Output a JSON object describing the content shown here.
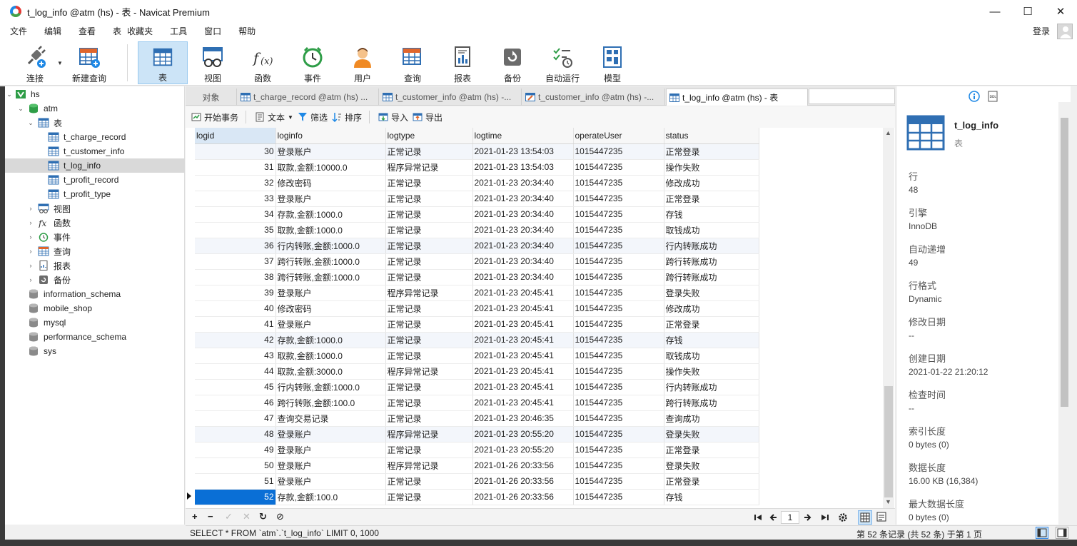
{
  "window": {
    "title": "t_log_info @atm (hs) - 表 - Navicat Premium",
    "controls": {
      "minimize": "—",
      "maximize": "☐",
      "close": "✕"
    }
  },
  "menu": {
    "items": [
      "文件",
      "编辑",
      "查看",
      "表",
      "收藏夹",
      "工具",
      "窗口",
      "帮助"
    ],
    "login": "登录"
  },
  "toolbar": {
    "buttons": [
      "连接",
      "新建查询",
      "表",
      "视图",
      "函数",
      "事件",
      "用户",
      "查询",
      "报表",
      "备份",
      "自动运行",
      "模型"
    ]
  },
  "nav": {
    "connection": "hs",
    "database": "atm",
    "tables_group": "表",
    "tables": [
      "t_charge_record",
      "t_customer_info",
      "t_log_info",
      "t_profit_record",
      "t_profit_type"
    ],
    "groups": [
      "视图",
      "函数",
      "事件",
      "查询",
      "报表",
      "备份"
    ],
    "databases": [
      "information_schema",
      "mobile_shop",
      "mysql",
      "performance_schema",
      "sys"
    ]
  },
  "tabs": {
    "objects": "对象",
    "items": [
      "t_charge_record @atm (hs) ...",
      "t_customer_info @atm (hs) -...",
      "t_customer_info @atm (hs) -...",
      "t_log_info @atm (hs) - 表"
    ]
  },
  "data_toolbar": {
    "begin_transaction": "开始事务",
    "text": "文本",
    "filter": "筛选",
    "sort": "排序",
    "import": "导入",
    "export": "导出"
  },
  "grid": {
    "columns": [
      "logid",
      "loginfo",
      "logtype",
      "logtime",
      "operateUser",
      "status"
    ],
    "rows": [
      [
        "30",
        "登录账户",
        "正常记录",
        "2021-01-23 13:54:03",
        "1015447235",
        "正常登录"
      ],
      [
        "31",
        "取款,金额:10000.0",
        "程序异常记录",
        "2021-01-23 13:54:03",
        "1015447235",
        "操作失败"
      ],
      [
        "32",
        "修改密码",
        "正常记录",
        "2021-01-23 20:34:40",
        "1015447235",
        "修改成功"
      ],
      [
        "33",
        "登录账户",
        "正常记录",
        "2021-01-23 20:34:40",
        "1015447235",
        "正常登录"
      ],
      [
        "34",
        "存款,金额:1000.0",
        "正常记录",
        "2021-01-23 20:34:40",
        "1015447235",
        "存钱"
      ],
      [
        "35",
        "取款,金额:1000.0",
        "正常记录",
        "2021-01-23 20:34:40",
        "1015447235",
        "取钱成功"
      ],
      [
        "36",
        "行内转账,金额:1000.0",
        "正常记录",
        "2021-01-23 20:34:40",
        "1015447235",
        "行内转账成功"
      ],
      [
        "37",
        "跨行转账,金额:1000.0",
        "正常记录",
        "2021-01-23 20:34:40",
        "1015447235",
        "跨行转账成功"
      ],
      [
        "38",
        "跨行转账,金额:1000.0",
        "正常记录",
        "2021-01-23 20:34:40",
        "1015447235",
        "跨行转账成功"
      ],
      [
        "39",
        "登录账户",
        "程序异常记录",
        "2021-01-23 20:45:41",
        "1015447235",
        "登录失败"
      ],
      [
        "40",
        "修改密码",
        "正常记录",
        "2021-01-23 20:45:41",
        "1015447235",
        "修改成功"
      ],
      [
        "41",
        "登录账户",
        "正常记录",
        "2021-01-23 20:45:41",
        "1015447235",
        "正常登录"
      ],
      [
        "42",
        "存款,金额:1000.0",
        "正常记录",
        "2021-01-23 20:45:41",
        "1015447235",
        "存钱"
      ],
      [
        "43",
        "取款,金额:1000.0",
        "正常记录",
        "2021-01-23 20:45:41",
        "1015447235",
        "取钱成功"
      ],
      [
        "44",
        "取款,金额:3000.0",
        "程序异常记录",
        "2021-01-23 20:45:41",
        "1015447235",
        "操作失败"
      ],
      [
        "45",
        "行内转账,金额:1000.0",
        "正常记录",
        "2021-01-23 20:45:41",
        "1015447235",
        "行内转账成功"
      ],
      [
        "46",
        "跨行转账,金额:100.0",
        "正常记录",
        "2021-01-23 20:45:41",
        "1015447235",
        "跨行转账成功"
      ],
      [
        "47",
        "查询交易记录",
        "正常记录",
        "2021-01-23 20:46:35",
        "1015447235",
        "查询成功"
      ],
      [
        "48",
        "登录账户",
        "程序异常记录",
        "2021-01-23 20:55:20",
        "1015447235",
        "登录失败"
      ],
      [
        "49",
        "登录账户",
        "正常记录",
        "2021-01-23 20:55:20",
        "1015447235",
        "正常登录"
      ],
      [
        "50",
        "登录账户",
        "程序异常记录",
        "2021-01-26 20:33:56",
        "1015447235",
        "登录失败"
      ],
      [
        "51",
        "登录账户",
        "正常记录",
        "2021-01-26 20:33:56",
        "1015447235",
        "正常登录"
      ],
      [
        "52",
        "存款,金额:100.0",
        "正常记录",
        "2021-01-26 20:33:56",
        "1015447235",
        "存钱"
      ]
    ],
    "selected_row": 22
  },
  "grid_bar": {
    "add": "+",
    "remove": "−",
    "apply": "✓",
    "discard": "✕",
    "refresh": "↻",
    "stop": "⊘",
    "page": "1"
  },
  "status": {
    "sql": "SELECT * FROM `atm`.`t_log_info` LIMIT 0, 1000",
    "records": "第 52 条记录 (共 52 条) 于第 1 页"
  },
  "info_panel": {
    "name": "t_log_info",
    "type": "表",
    "fields": [
      {
        "label": "行",
        "value": "48"
      },
      {
        "label": "引擎",
        "value": "InnoDB"
      },
      {
        "label": "自动递增",
        "value": "49"
      },
      {
        "label": "行格式",
        "value": "Dynamic"
      },
      {
        "label": "修改日期",
        "value": "--"
      },
      {
        "label": "创建日期",
        "value": "2021-01-22 21:20:12"
      },
      {
        "label": "检查时间",
        "value": "--"
      },
      {
        "label": "索引长度",
        "value": "0 bytes (0)"
      },
      {
        "label": "数据长度",
        "value": "16.00 KB (16,384)"
      },
      {
        "label": "最大数据长度",
        "value": "0 bytes (0)"
      }
    ]
  },
  "colors": {
    "accent": "#0a6fd6",
    "active_tool": "#cce4f7",
    "icon_blue": "#2f6fb3",
    "db_green": "#2e9d47"
  }
}
